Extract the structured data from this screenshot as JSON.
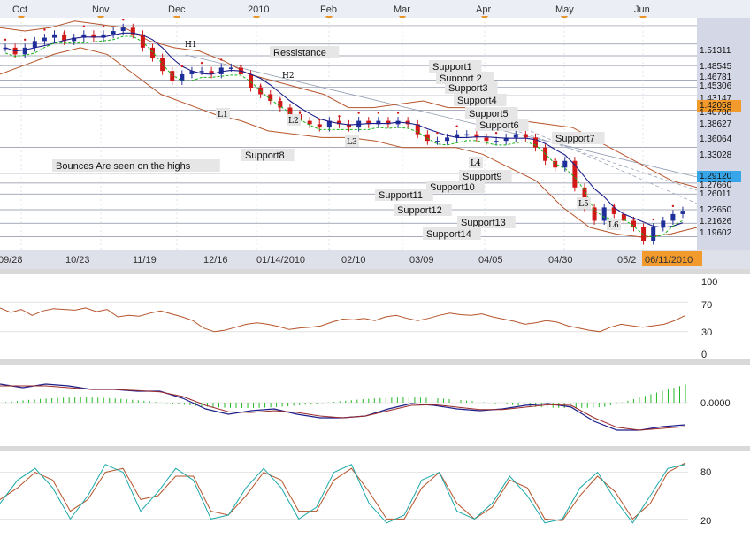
{
  "top_axis": {
    "months": [
      {
        "label": "Oct",
        "pos": 0.0
      },
      {
        "label": "Nov",
        "pos": 0.25
      },
      {
        "label": "Dec",
        "pos": 0.5
      },
      {
        "label": "2010",
        "pos": 0.75
      },
      {
        "label": "Feb",
        "pos": 1.0
      },
      {
        "label": "Mar",
        "pos": 1.2
      },
      {
        "label": "Apr",
        "pos": 1.45
      },
      {
        "label": "May",
        "pos": 1.7
      },
      {
        "label": "Jun",
        "pos": 1.95
      }
    ]
  },
  "price_axis": {
    "labels": [
      "1.51311",
      "1.48545",
      "1.46781",
      "1.45306",
      "1.43147",
      "1.42058",
      "1.40780",
      "1.38627",
      "1.36064",
      "1.33028",
      "1.29120",
      "1.27660",
      "1.26011",
      "1.23650",
      "1.21626",
      "1.19602"
    ],
    "highlight_orange": "1.42058",
    "highlight_blue": "1.29120"
  },
  "date_axis": {
    "labels": [
      "09/28",
      "10/23",
      "11/19",
      "12/16",
      "01/14/2010",
      "02/10",
      "03/09",
      "04/05",
      "04/30",
      "05/2"
    ],
    "current_date": "06/11/2010"
  },
  "annotations": [
    "Ressistance",
    "Support1",
    "Support 2",
    "Support3",
    "Support4",
    "Support5",
    "Support6",
    "Support7",
    "Support8",
    "Support9",
    "Support10",
    "Support11",
    "Support12",
    "Support13",
    "Support14",
    "Bounces Are seen on the highs"
  ],
  "peak_labels": [
    "H1",
    "H2",
    "L1",
    "L2",
    "L3",
    "L4",
    "L5",
    "L6"
  ],
  "rsi_axis": [
    "100",
    "70",
    "30",
    "0"
  ],
  "macd_axis": [
    "0.0000"
  ],
  "stoch_axis": [
    "80",
    "20"
  ],
  "colors": {
    "bull_candle": "#1f2f9a",
    "bear_candle": "#d01818",
    "bollinger": "#b5542a",
    "ma_blue": "#1c1f8a",
    "ma_green": "#16b316",
    "sar": "#d01818",
    "orange_highlight": "#f39a2c",
    "blue_highlight": "#36a6e8",
    "axis_panel": "#d4d7e6",
    "stoch_k": "#1aa8a8",
    "stoch_d": "#b5542a"
  },
  "chart_data": [
    {
      "type": "candlestick",
      "title": "",
      "instrument_axis": "price",
      "x_range": [
        "09/28/2009",
        "06/11/2010"
      ],
      "ylim": [
        1.19,
        1.525
      ],
      "close_path": [
        1.48,
        1.47,
        1.48,
        1.49,
        1.495,
        1.5,
        1.49,
        1.495,
        1.5,
        1.495,
        1.5,
        1.505,
        1.51,
        1.5,
        1.48,
        1.465,
        1.445,
        1.43,
        1.44,
        1.445,
        1.445,
        1.44,
        1.45,
        1.45,
        1.44,
        1.42,
        1.41,
        1.4,
        1.39,
        1.38,
        1.37,
        1.365,
        1.36,
        1.37,
        1.365,
        1.36,
        1.37,
        1.365,
        1.37,
        1.365,
        1.37,
        1.365,
        1.35,
        1.34,
        1.34,
        1.345,
        1.35,
        1.35,
        1.345,
        1.34,
        1.34,
        1.345,
        1.35,
        1.345,
        1.33,
        1.31,
        1.3,
        1.31,
        1.27,
        1.24,
        1.22,
        1.24,
        1.23,
        1.22,
        1.21,
        1.19,
        1.21,
        1.22,
        1.23,
        1.235
      ],
      "series": [
        {
          "name": "Upper Bollinger",
          "values": [
            1.51,
            1.505,
            1.51,
            1.52,
            1.515,
            1.51,
            1.49,
            1.48,
            1.475,
            1.46,
            1.44,
            1.43,
            1.42,
            1.41,
            1.39,
            1.39,
            1.395,
            1.4,
            1.39,
            1.39,
            1.38,
            1.37,
            1.365,
            1.36,
            1.34,
            1.32,
            1.3,
            1.28,
            1.27
          ]
        },
        {
          "name": "Lower Bollinger",
          "values": [
            1.44,
            1.455,
            1.47,
            1.48,
            1.47,
            1.44,
            1.41,
            1.395,
            1.38,
            1.37,
            1.355,
            1.35,
            1.345,
            1.345,
            1.34,
            1.33,
            1.33,
            1.33,
            1.32,
            1.3,
            1.28,
            1.24,
            1.21,
            1.2,
            1.195,
            1.2,
            1.21
          ]
        }
      ]
    },
    {
      "type": "line",
      "name": "RSI",
      "ylim": [
        0,
        100
      ],
      "values": [
        62,
        56,
        60,
        52,
        58,
        61,
        60,
        59,
        62,
        57,
        60,
        50,
        52,
        51,
        55,
        58,
        54,
        50,
        45,
        35,
        30,
        32,
        36,
        40,
        42,
        40,
        37,
        33,
        35,
        36,
        38,
        43,
        47,
        46,
        48,
        45,
        50,
        52,
        48,
        45,
        48,
        52,
        55,
        53,
        52,
        54,
        50,
        47,
        44,
        40,
        42,
        45,
        43,
        38,
        35,
        32,
        30,
        36,
        40,
        38,
        36,
        38,
        40,
        45,
        52
      ]
    },
    {
      "type": "line",
      "name": "MACD",
      "ylim": [
        -1,
        1
      ],
      "series": [
        {
          "name": "MACD",
          "values": [
            0.6,
            0.5,
            0.6,
            0.55,
            0.45,
            0.45,
            0.4,
            0.4,
            0.2,
            -0.1,
            -0.25,
            -0.15,
            -0.1,
            -0.25,
            -0.35,
            -0.35,
            -0.3,
            -0.1,
            0.05,
            0.0,
            -0.1,
            -0.15,
            -0.1,
            0.0,
            0.05,
            -0.05,
            -0.45,
            -0.7,
            -0.7,
            -0.6,
            -0.55
          ]
        },
        {
          "name": "Signal",
          "values": [
            0.55,
            0.55,
            0.55,
            0.5,
            0.45,
            0.45,
            0.42,
            0.38,
            0.25,
            0.0,
            -0.18,
            -0.2,
            -0.15,
            -0.2,
            -0.3,
            -0.35,
            -0.3,
            -0.15,
            0.0,
            0.02,
            -0.05,
            -0.12,
            -0.12,
            -0.05,
            0.02,
            0.0,
            -0.35,
            -0.62,
            -0.7,
            -0.65,
            -0.6
          ]
        }
      ]
    },
    {
      "type": "line",
      "name": "Stochastic",
      "ylim": [
        0,
        100
      ],
      "series": [
        {
          "name": "%K",
          "values": [
            40,
            70,
            85,
            60,
            20,
            50,
            90,
            80,
            30,
            55,
            85,
            70,
            20,
            25,
            60,
            85,
            60,
            20,
            35,
            80,
            90,
            40,
            15,
            25,
            70,
            80,
            30,
            20,
            40,
            75,
            50,
            15,
            20,
            60,
            80,
            45,
            15,
            50,
            85,
            90
          ]
        },
        {
          "name": "%D",
          "values": [
            45,
            60,
            80,
            70,
            30,
            45,
            80,
            85,
            45,
            50,
            75,
            75,
            30,
            25,
            50,
            80,
            70,
            30,
            30,
            70,
            85,
            55,
            20,
            20,
            60,
            80,
            40,
            20,
            35,
            70,
            60,
            20,
            18,
            50,
            75,
            55,
            20,
            40,
            80,
            92
          ]
        }
      ]
    }
  ]
}
